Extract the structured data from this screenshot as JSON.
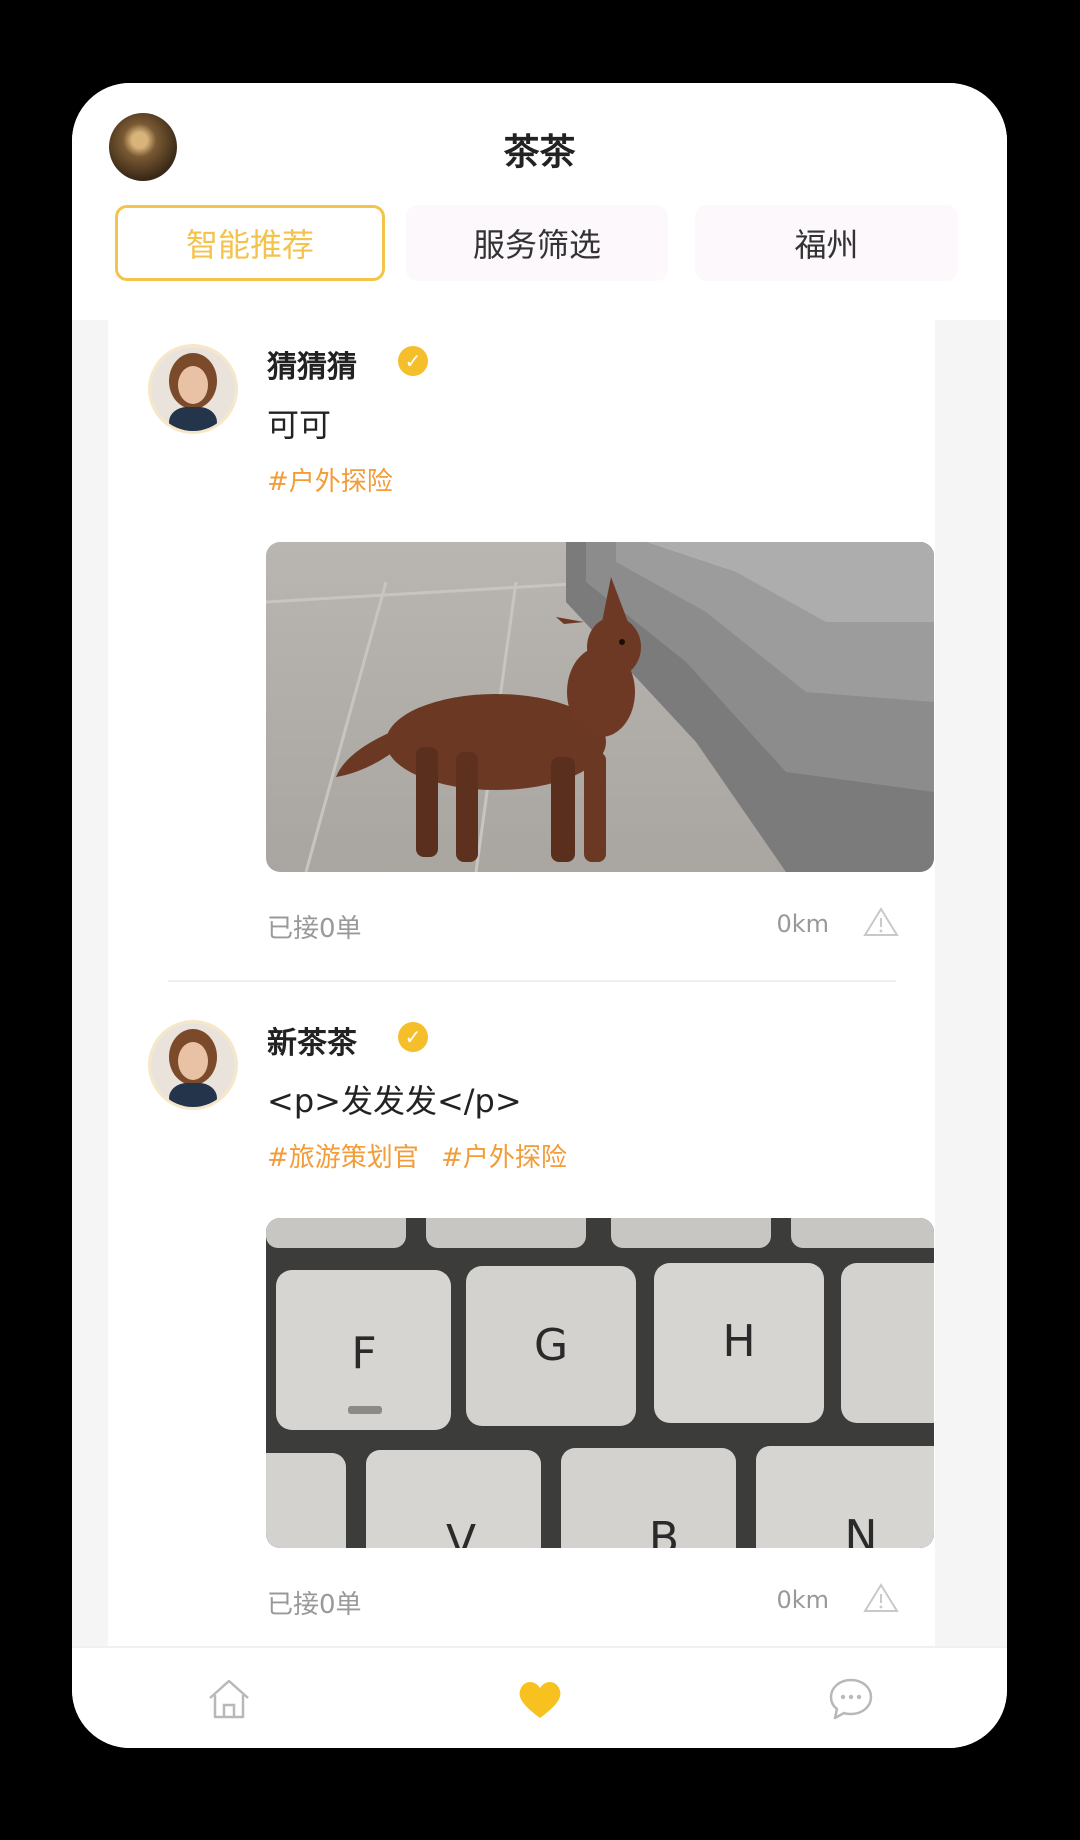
{
  "header": {
    "title": "茶茶",
    "avatar_icon": "user-avatar",
    "tabs": [
      {
        "label": "智能推荐",
        "active": true
      },
      {
        "label": "服务筛选",
        "active": false
      },
      {
        "label": "福州",
        "active": false
      }
    ]
  },
  "posts": [
    {
      "name": "猜猜猜",
      "verified": "✓",
      "text": "可可",
      "tags": [
        "#户外探险"
      ],
      "image": "photo-dog",
      "orders": "已接0单",
      "distance": "0km"
    },
    {
      "name": "新茶茶",
      "verified": "✓",
      "text": "<p>发发发</p>",
      "tags": [
        "#旅游策划官",
        "#户外探险"
      ],
      "image": "photo-keyboard",
      "keys_row1": [
        "F",
        "G",
        "H"
      ],
      "keys_row2": [
        "V",
        "B",
        "N"
      ],
      "orders": "已接0单",
      "distance": "0km"
    }
  ],
  "tabbar": {
    "items": [
      {
        "icon": "home-icon",
        "active": false
      },
      {
        "icon": "heart-icon",
        "active": true
      },
      {
        "icon": "chat-icon",
        "active": false
      }
    ]
  },
  "colors": {
    "accent": "#f3c34c",
    "tag": "#f29c3a",
    "verified": "#f5bf2b",
    "muted": "#999999"
  }
}
